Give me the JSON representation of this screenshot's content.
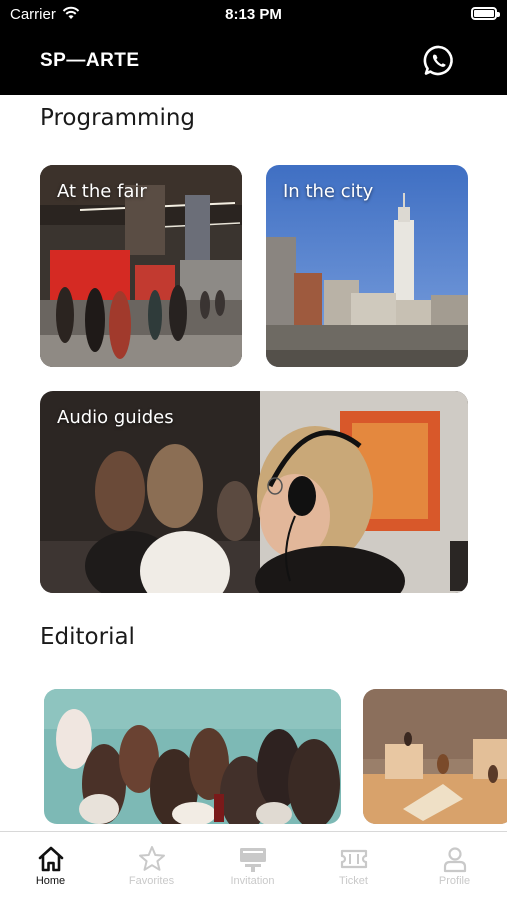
{
  "status_bar": {
    "carrier": "Carrier",
    "time": "8:13 PM"
  },
  "header": {
    "logo": "SP—ARTE",
    "whatsapp_icon": "whatsapp-icon"
  },
  "programming": {
    "title": "Programming",
    "cards": [
      {
        "label": "At the fair"
      },
      {
        "label": "In the city"
      },
      {
        "label": "Audio guides"
      }
    ]
  },
  "editorial": {
    "title": "Editorial"
  },
  "tabbar": {
    "active_color": "#111111",
    "inactive_color": "#c9c9c9",
    "tabs": [
      {
        "label": "Home",
        "icon": "home-icon"
      },
      {
        "label": "Favorites",
        "icon": "star-icon"
      },
      {
        "label": "Invitation",
        "icon": "invitation-icon"
      },
      {
        "label": "Ticket",
        "icon": "ticket-icon"
      },
      {
        "label": "Profile",
        "icon": "profile-icon"
      }
    ]
  }
}
